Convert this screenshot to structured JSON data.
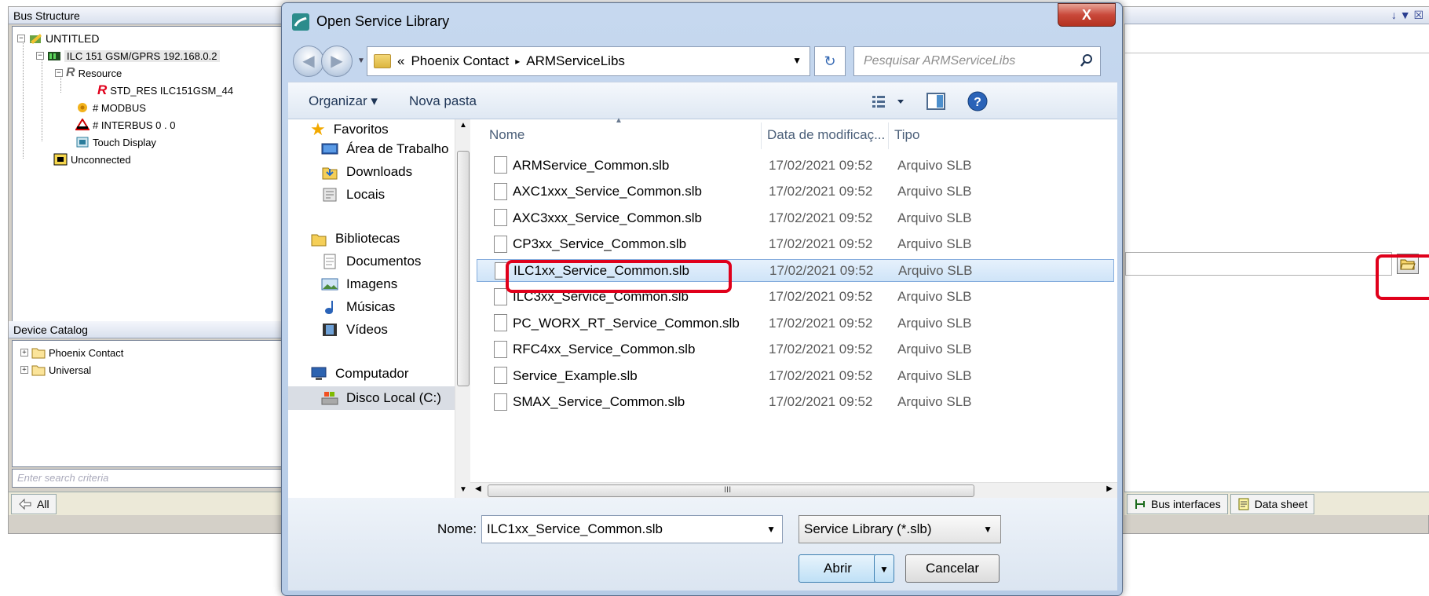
{
  "app": {
    "bus_structure": {
      "title": "Bus Structure",
      "tree": [
        "UNTITLED",
        "ILC 151 GSM/GPRS 192.168.0.2",
        "Resource",
        "STD_RES ILC151GSM_44",
        "# MODBUS",
        "# INTERBUS 0 . 0",
        "Touch Display",
        "Unconnected"
      ]
    },
    "device_catalog": {
      "title": "Device Catalog",
      "items": [
        "Phoenix Contact",
        "Universal"
      ],
      "search_placeholder": "Enter search criteria",
      "tab_all": "All"
    },
    "right_tabs": [
      "Bus interfaces",
      "Data sheet"
    ],
    "window_icons": "↓ ▼ ☒"
  },
  "dialog": {
    "title": "Open Service Library",
    "close_label": "X",
    "breadcrumb": [
      "«",
      "Phoenix Contact",
      "▸",
      "ARMServiceLibs"
    ],
    "search_placeholder": "Pesquisar ARMServiceLibs",
    "toolbar": {
      "organize": "Organizar ▾",
      "new_folder": "Nova pasta"
    },
    "nav": {
      "favorites": "Favoritos",
      "desktop": "Área de Trabalho",
      "downloads": "Downloads",
      "locais": "Locais",
      "libraries": "Bibliotecas",
      "documents": "Documentos",
      "images": "Imagens",
      "music": "Músicas",
      "videos": "Vídeos",
      "computer": "Computador",
      "local_disk": "Disco Local (C:)"
    },
    "columns": {
      "name": "Nome",
      "date": "Data de modificaç...",
      "type": "Tipo"
    },
    "files": [
      {
        "name": "ARMService_Common.slb",
        "date": "17/02/2021 09:52",
        "type": "Arquivo SLB"
      },
      {
        "name": "AXC1xxx_Service_Common.slb",
        "date": "17/02/2021 09:52",
        "type": "Arquivo SLB"
      },
      {
        "name": "AXC3xxx_Service_Common.slb",
        "date": "17/02/2021 09:52",
        "type": "Arquivo SLB"
      },
      {
        "name": "CP3xx_Service_Common.slb",
        "date": "17/02/2021 09:52",
        "type": "Arquivo SLB"
      },
      {
        "name": "ILC1xx_Service_Common.slb",
        "date": "17/02/2021 09:52",
        "type": "Arquivo SLB"
      },
      {
        "name": "ILC3xx_Service_Common.slb",
        "date": "17/02/2021 09:52",
        "type": "Arquivo SLB"
      },
      {
        "name": "PC_WORX_RT_Service_Common.slb",
        "date": "17/02/2021 09:52",
        "type": "Arquivo SLB"
      },
      {
        "name": "RFC4xx_Service_Common.slb",
        "date": "17/02/2021 09:52",
        "type": "Arquivo SLB"
      },
      {
        "name": "Service_Example.slb",
        "date": "17/02/2021 09:52",
        "type": "Arquivo SLB"
      },
      {
        "name": "SMAX_Service_Common.slb",
        "date": "17/02/2021 09:52",
        "type": "Arquivo SLB"
      }
    ],
    "selected_file_index": 4,
    "filename_label": "Nome:",
    "filename_value": "ILC1xx_Service_Common.slb",
    "file_type": "Service Library (*.slb)",
    "open_button": "Abrir",
    "cancel_button": "Cancelar",
    "scroll_mark": "III"
  },
  "colors": {
    "highlight": "#e0001b",
    "selection": "#cfe4f8"
  }
}
